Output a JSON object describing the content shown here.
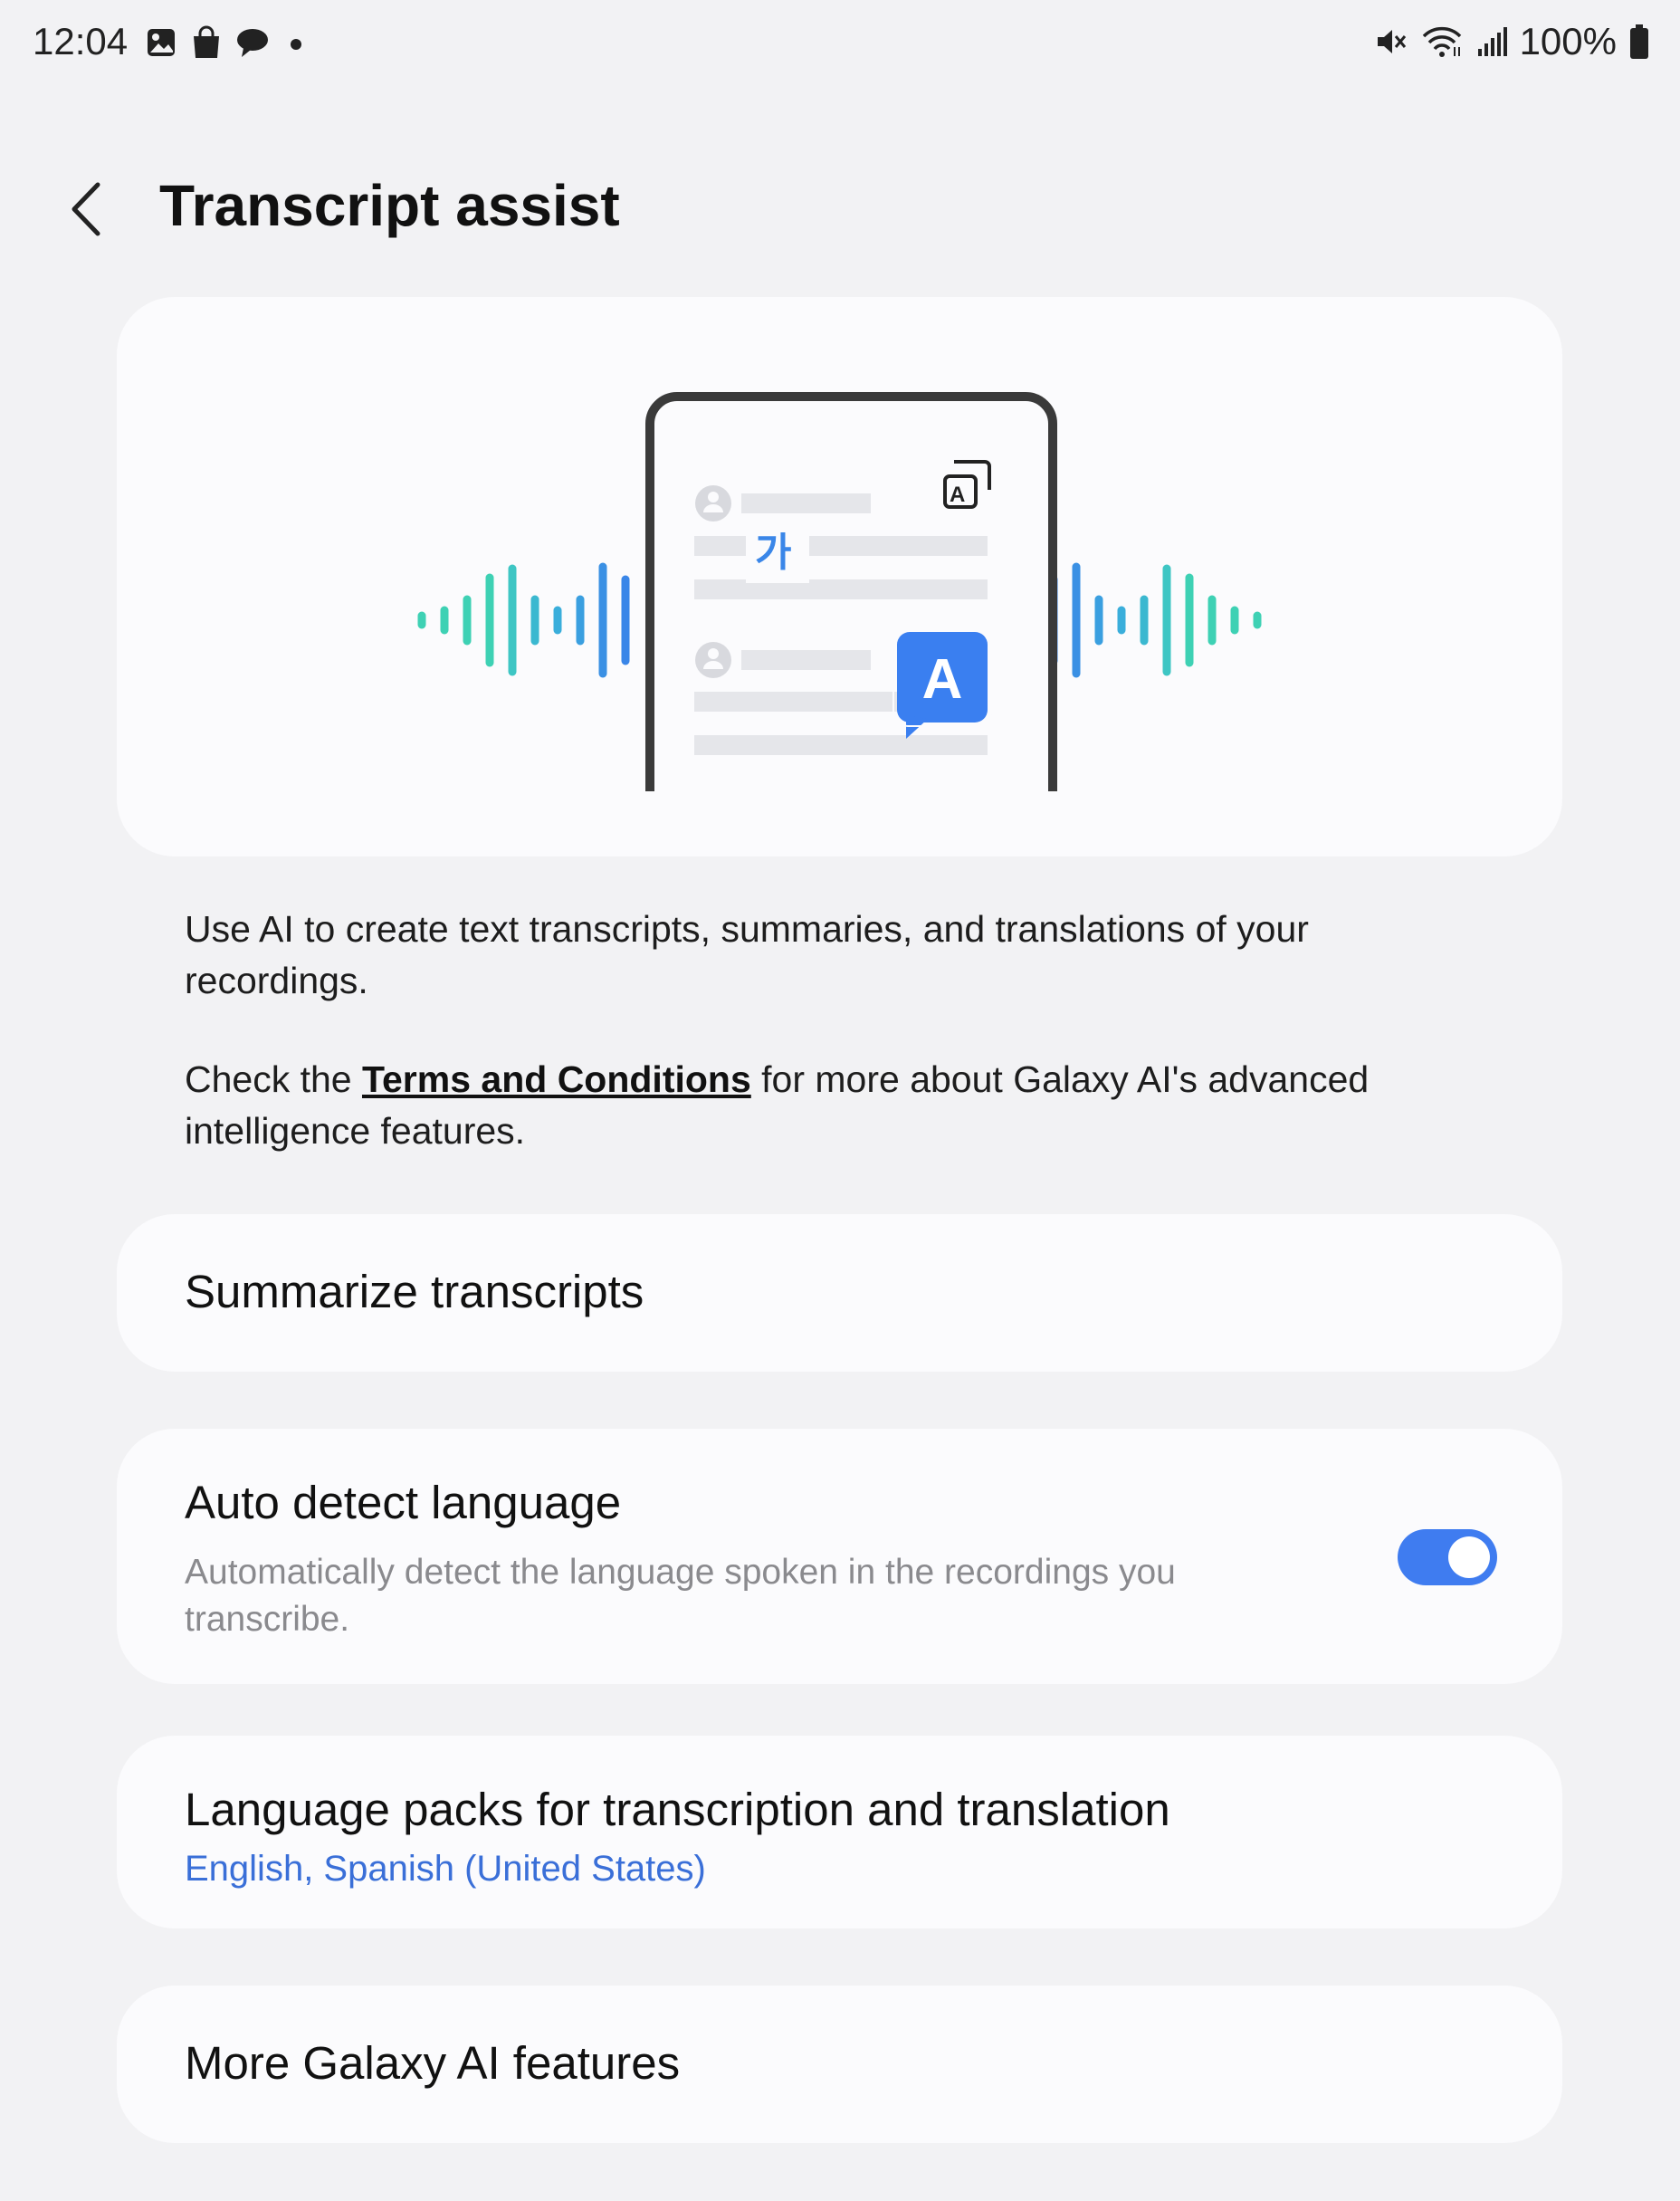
{
  "status_bar": {
    "time": "12:04",
    "left_icons": [
      "gallery-icon",
      "shopping-bag-icon",
      "chat-bubble-icon",
      "dot-icon"
    ],
    "right_icons": [
      "mute-icon",
      "wifi-icon",
      "signal-icon",
      "battery-icon"
    ],
    "battery": "100%"
  },
  "header": {
    "title": "Transcript assist"
  },
  "hero": {
    "korean_char": "가",
    "latin_char": "A"
  },
  "description": {
    "line1": "Use AI to create text transcripts, summaries, and translations of your recordings.",
    "line2_prefix": "Check the ",
    "line2_link": "Terms and Conditions",
    "line2_suffix": " for more about Galaxy AI's advanced intelligence features."
  },
  "items": {
    "summarize": {
      "title": "Summarize transcripts"
    },
    "auto_detect": {
      "title": "Auto detect language",
      "subtitle": "Automatically detect the language spoken in the recordings you transcribe.",
      "toggle_on": true
    },
    "language_packs": {
      "title": "Language packs for transcription and translation",
      "subtitle": "English, Spanish (United States)"
    },
    "more": {
      "title": "More Galaxy AI features"
    }
  },
  "colors": {
    "accent": "#3f7cf0",
    "link_blue": "#3a6fd8",
    "background": "#f2f2f4",
    "card": "#fbfbfd",
    "teal": "#3ed1b4",
    "blue": "#3a86e8"
  }
}
